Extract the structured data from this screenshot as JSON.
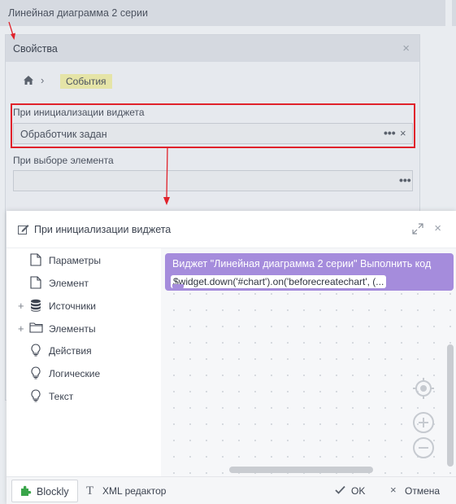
{
  "widget": {
    "title": "Линейная диаграмма 2 серии"
  },
  "properties": {
    "title": "Свойства",
    "close_icon": "close-icon",
    "breadcrumb": {
      "home_icon": "home-icon",
      "separator": "›",
      "current": "События"
    },
    "on_init": {
      "label": "При инициализации виджета",
      "value": "Обработчик задан",
      "dots": "•••",
      "clear": "×"
    },
    "on_select": {
      "label": "При выборе элемента",
      "value": "",
      "dots": "•••"
    }
  },
  "dialog": {
    "title": "При инициализации виджета",
    "close": "×",
    "toolbox": [
      {
        "label": "Параметры",
        "icon": "page-icon",
        "expandable": false
      },
      {
        "label": "Элемент",
        "icon": "page-icon",
        "expandable": false
      },
      {
        "label": "Источники",
        "icon": "database-icon",
        "expandable": true
      },
      {
        "label": "Элементы",
        "icon": "folder-icon",
        "expandable": true
      },
      {
        "label": "Действия",
        "icon": "lightbulb-icon",
        "expandable": false
      },
      {
        "label": "Логические",
        "icon": "lightbulb-icon",
        "expandable": false
      },
      {
        "label": "Текст",
        "icon": "lightbulb-icon",
        "expandable": false
      }
    ],
    "toolbox_plus": "+",
    "block": {
      "header": "Виджет \"Линейная диаграмма 2 серии\" Выполнить код",
      "code": "$widget.down('#chart').on('beforecreatechart', (..."
    },
    "footer": {
      "blockly": "Blockly",
      "xml_icon": "T",
      "xml": "XML редактор",
      "ok": "OK",
      "cancel_icon": "×",
      "cancel": "Отмена"
    }
  },
  "colors": {
    "block": "#a58cdc",
    "highlight": "#e0222b",
    "crumb_tag": "#e5e4a7"
  }
}
